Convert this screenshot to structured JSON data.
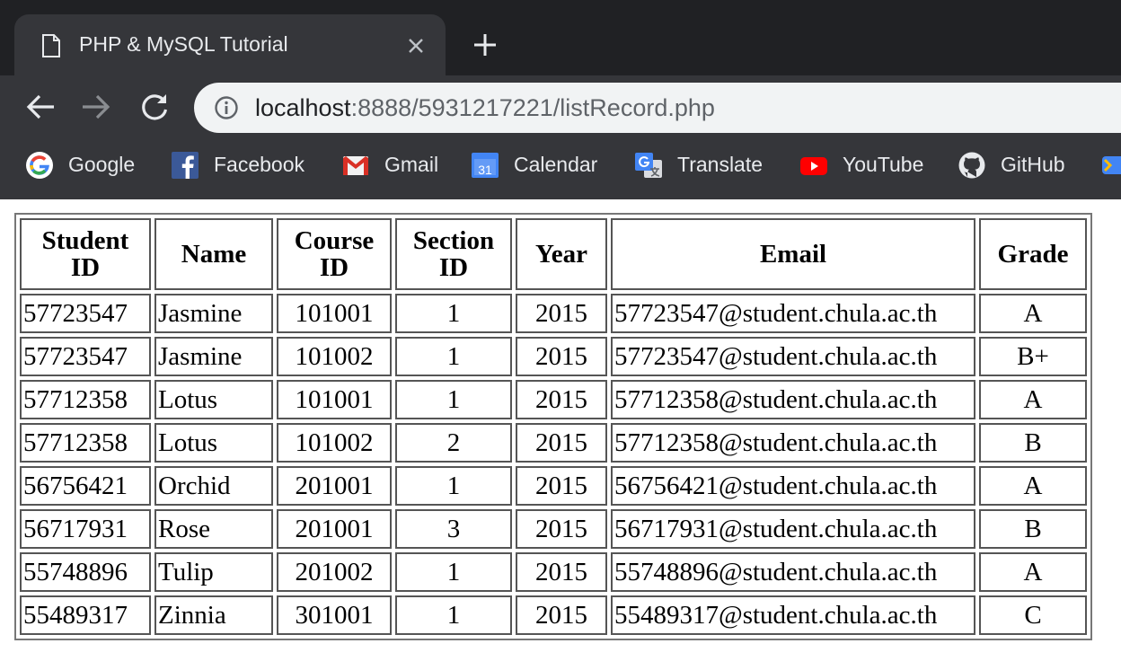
{
  "browser": {
    "tab_title": "PHP & MySQL Tutorial",
    "url_host": "localhost",
    "url_rest": ":8888/5931217221/listRecord.php",
    "bookmarks": [
      {
        "label": "Google",
        "icon": "google-icon"
      },
      {
        "label": "Facebook",
        "icon": "facebook-icon"
      },
      {
        "label": "Gmail",
        "icon": "gmail-icon"
      },
      {
        "label": "Calendar",
        "icon": "calendar-icon",
        "icon_text": "31"
      },
      {
        "label": "Translate",
        "icon": "translate-icon"
      },
      {
        "label": "YouTube",
        "icon": "youtube-icon"
      },
      {
        "label": "GitHub",
        "icon": "github-icon"
      }
    ],
    "colors": {
      "tabstrip": "#202124",
      "toolbar": "#35363a",
      "omnibox": "#f1f3f4"
    }
  },
  "table": {
    "headers": [
      [
        "Student",
        "ID"
      ],
      [
        "Name"
      ],
      [
        "Course",
        "ID"
      ],
      [
        "Section",
        "ID"
      ],
      [
        "Year"
      ],
      [
        "Email"
      ],
      [
        "Grade"
      ]
    ],
    "rows": [
      [
        "57723547",
        "Jasmine",
        "101001",
        "1",
        "2015",
        "57723547@student.chula.ac.th",
        "A"
      ],
      [
        "57723547",
        "Jasmine",
        "101002",
        "1",
        "2015",
        "57723547@student.chula.ac.th",
        "B+"
      ],
      [
        "57712358",
        "Lotus",
        "101001",
        "1",
        "2015",
        "57712358@student.chula.ac.th",
        "A"
      ],
      [
        "57712358",
        "Lotus",
        "101002",
        "2",
        "2015",
        "57712358@student.chula.ac.th",
        "B"
      ],
      [
        "56756421",
        "Orchid",
        "201001",
        "1",
        "2015",
        "56756421@student.chula.ac.th",
        "A"
      ],
      [
        "56717931",
        "Rose",
        "201001",
        "3",
        "2015",
        "56717931@student.chula.ac.th",
        "B"
      ],
      [
        "55748896",
        "Tulip",
        "201002",
        "1",
        "2015",
        "55748896@student.chula.ac.th",
        "A"
      ],
      [
        "55489317",
        "Zinnia",
        "301001",
        "1",
        "2015",
        "55489317@student.chula.ac.th",
        "C"
      ]
    ]
  }
}
